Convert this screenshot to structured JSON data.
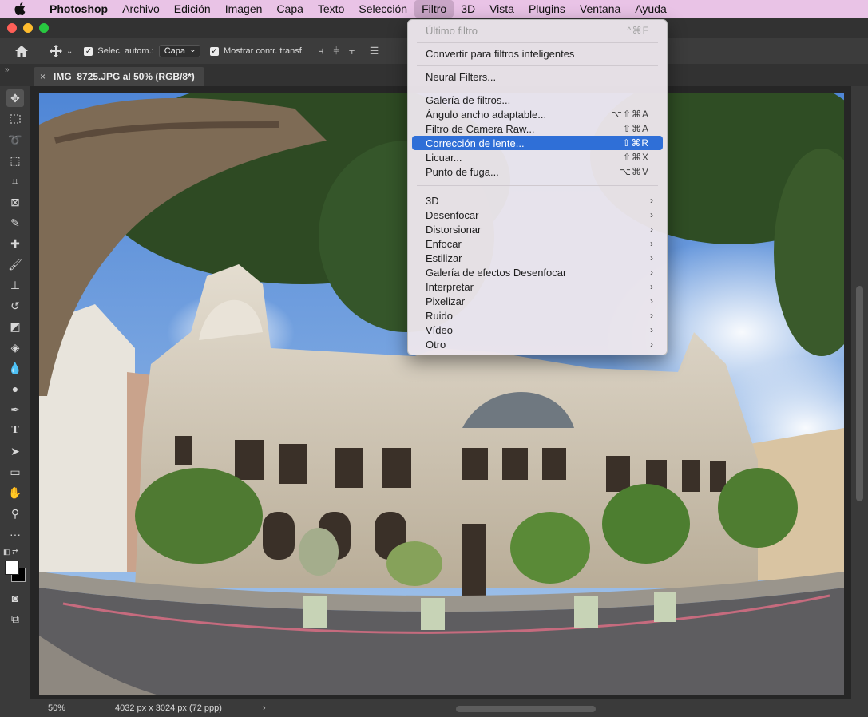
{
  "menubar": {
    "items": [
      "Photoshop",
      "Archivo",
      "Edición",
      "Imagen",
      "Capa",
      "Texto",
      "Selección",
      "Filtro",
      "3D",
      "Vista",
      "Plugins",
      "Ventana",
      "Ayuda"
    ],
    "active": "Filtro"
  },
  "options": {
    "auto_select_label": "Selec. autom.:",
    "auto_select_value": "Capa",
    "show_transform_label": "Mostrar contr. transf."
  },
  "document_tab": {
    "title": "IMG_8725.JPG al 50% (RGB/8*)",
    "close": "×"
  },
  "filter_menu": {
    "items": [
      {
        "label": "Último filtro",
        "shortcut": "^⌘F",
        "disabled": true
      },
      {
        "separator": true
      },
      {
        "label": "Convertir para filtros inteligentes",
        "shortcut": ""
      },
      {
        "separator": true
      },
      {
        "label": "Neural Filters...",
        "shortcut": ""
      },
      {
        "separator": true
      },
      {
        "label": "Galería de filtros...",
        "shortcut": ""
      },
      {
        "label": "Ángulo ancho adaptable...",
        "shortcut": "⌥⇧⌘A"
      },
      {
        "label": "Filtro de Camera Raw...",
        "shortcut": "⇧⌘A"
      },
      {
        "label": "Corrección de lente...",
        "shortcut": "⇧⌘R",
        "highlighted": true
      },
      {
        "label": "Licuar...",
        "shortcut": "⇧⌘X"
      },
      {
        "label": "Punto de fuga...",
        "shortcut": "⌥⌘V"
      },
      {
        "separator": true
      },
      {
        "label": "3D",
        "submenu": true
      },
      {
        "label": "Desenfocar",
        "submenu": true
      },
      {
        "label": "Distorsionar",
        "submenu": true
      },
      {
        "label": "Enfocar",
        "submenu": true
      },
      {
        "label": "Estilizar",
        "submenu": true
      },
      {
        "label": "Galería de efectos Desenfocar",
        "submenu": true
      },
      {
        "label": "Interpretar",
        "submenu": true
      },
      {
        "label": "Pixelizar",
        "submenu": true
      },
      {
        "label": "Ruido",
        "submenu": true
      },
      {
        "label": "Vídeo",
        "submenu": true
      },
      {
        "label": "Otro",
        "submenu": true
      }
    ]
  },
  "status": {
    "zoom": "50%",
    "dimensions": "4032 px x 3024 px (72 ppp)",
    "arrow": "›"
  },
  "colors": {
    "menubar": "#e9c3e6",
    "highlight": "#2f6fd7",
    "panel": "#3c3c3c"
  }
}
